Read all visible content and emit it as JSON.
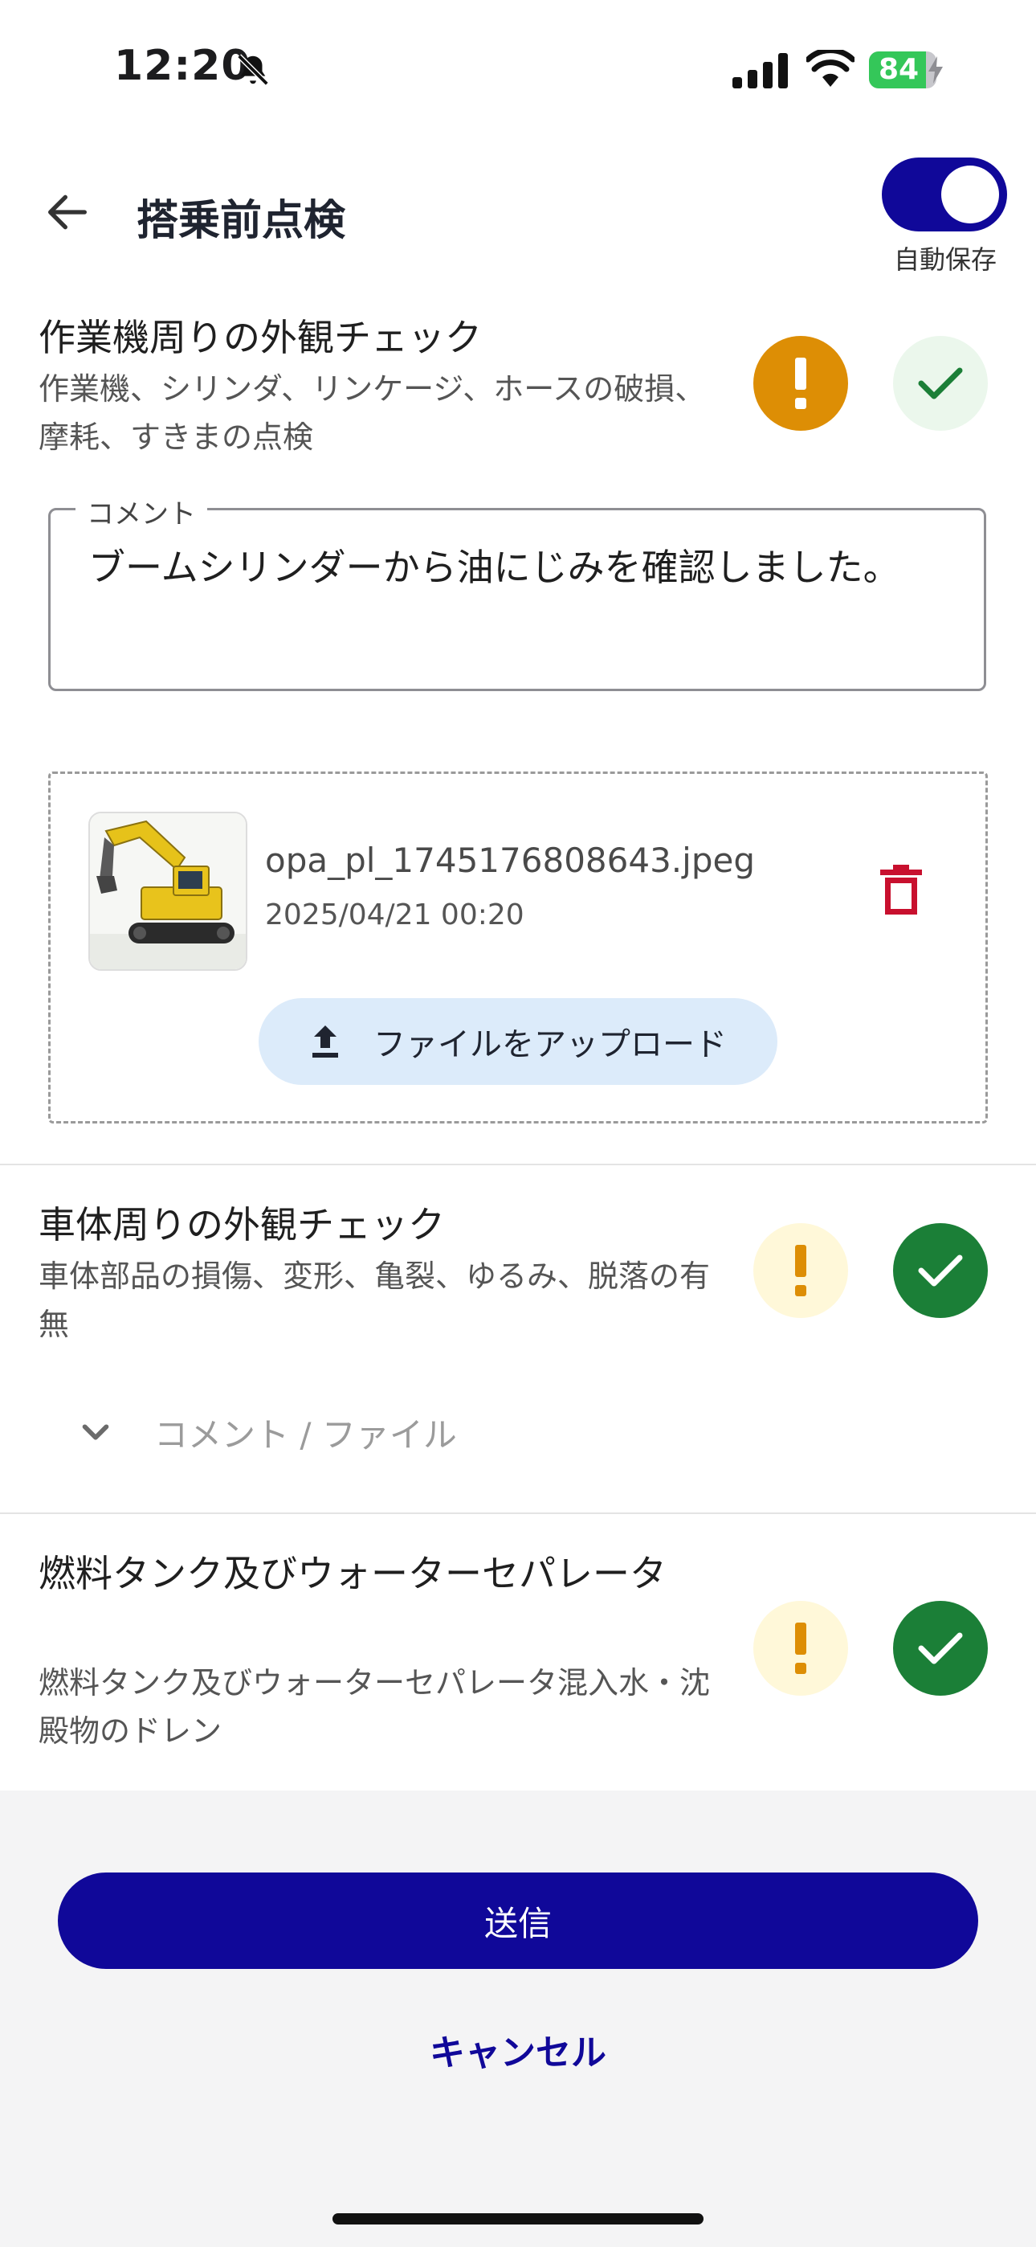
{
  "status_bar": {
    "time": "12:20",
    "battery": "84",
    "battery_level": 0.84
  },
  "header": {
    "title": "搭乗前点検",
    "auto_save_label": "自動保存",
    "auto_save_on": true
  },
  "items": [
    {
      "title": "作業機周りの外観チェック",
      "description": "作業機、シリンダ、リンケージ、ホースの破損、摩耗、すきまの点検",
      "state": "warning",
      "comment_label": "コメント",
      "comment": "ブームシリンダーから油にじみを確認しました。",
      "file": {
        "name": "opa_pl_1745176808643.jpeg",
        "date": "2025/04/21 00:20"
      },
      "upload_label": "ファイルをアップロード"
    },
    {
      "title": "車体周りの外観チェック",
      "description": "車体部品の損傷、変形、亀裂、ゆるみ、脱落の有無",
      "state": "ok",
      "expand_label": "コメント / ファイル"
    },
    {
      "title": "燃料タンク及びウォーターセパレータ",
      "description": "燃料タンク及びウォーターセパレータ混入水・沈殿物のドレン",
      "state": "ok"
    }
  ],
  "footer": {
    "submit_label": "送信",
    "cancel_label": "キャンセル"
  },
  "colors": {
    "primary": "#100899",
    "warning_active": "#dd8e05",
    "warning_inactive": "#fff8d9",
    "ok_active": "#1b7f37",
    "ok_inactive": "#ebf7ec",
    "delete": "#c8102e"
  }
}
